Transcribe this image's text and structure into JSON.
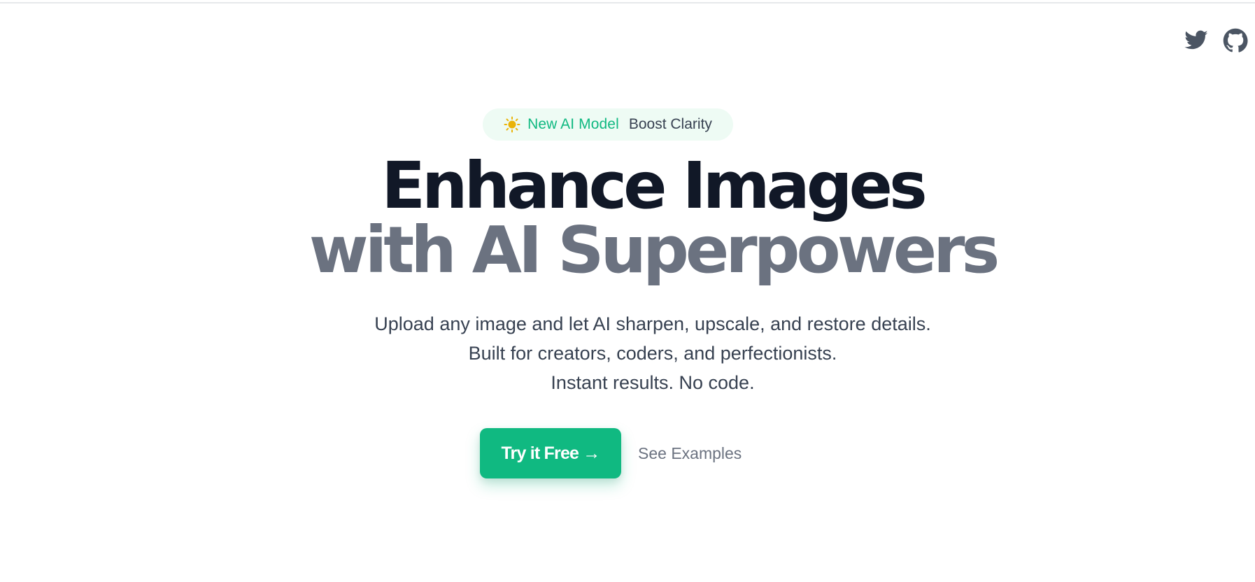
{
  "header": {
    "social": [
      {
        "icon": "twitter-icon"
      },
      {
        "icon": "github-icon"
      }
    ]
  },
  "badge": {
    "icon": "sun-icon",
    "tag": "New AI Model",
    "text": "Boost Clarity"
  },
  "hero": {
    "headline_line1": "Enhance Images",
    "headline_line2": "with AI Superpowers",
    "sub_line1": "Upload any image and let AI sharpen, upscale, and restore details.",
    "sub_line2": "Built for creators, coders, and perfectionists.",
    "sub_line3": "Instant results. No code."
  },
  "cta": {
    "primary_label": "Try it Free →",
    "secondary_label": "See Examples"
  },
  "colors": {
    "accent": "#10b981",
    "heading_dark": "#111827",
    "heading_muted": "#6b7280",
    "body_text": "#374151",
    "badge_bg": "#eefbf4"
  }
}
